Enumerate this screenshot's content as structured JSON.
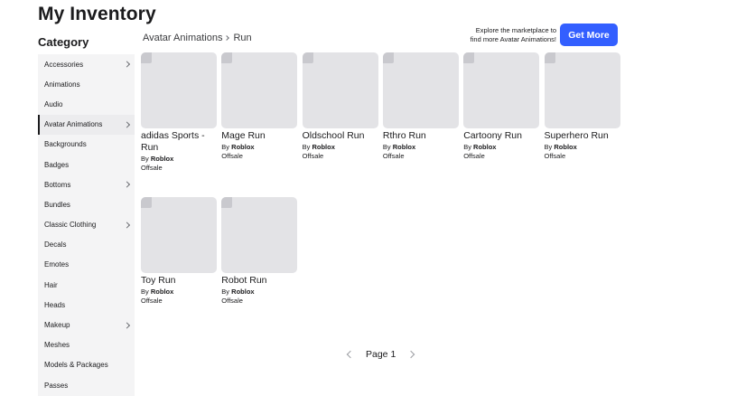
{
  "page_title": "My Inventory",
  "category_heading": "Category",
  "sidebar": {
    "items": [
      {
        "label": "Accessories",
        "has_children": true,
        "active": false
      },
      {
        "label": "Animations",
        "has_children": false,
        "active": false
      },
      {
        "label": "Audio",
        "has_children": false,
        "active": false
      },
      {
        "label": "Avatar Animations",
        "has_children": true,
        "active": true
      },
      {
        "label": "Backgrounds",
        "has_children": false,
        "active": false
      },
      {
        "label": "Badges",
        "has_children": false,
        "active": false
      },
      {
        "label": "Bottoms",
        "has_children": true,
        "active": false
      },
      {
        "label": "Bundles",
        "has_children": false,
        "active": false
      },
      {
        "label": "Classic Clothing",
        "has_children": true,
        "active": false
      },
      {
        "label": "Decals",
        "has_children": false,
        "active": false
      },
      {
        "label": "Emotes",
        "has_children": false,
        "active": false
      },
      {
        "label": "Hair",
        "has_children": false,
        "active": false
      },
      {
        "label": "Heads",
        "has_children": false,
        "active": false
      },
      {
        "label": "Makeup",
        "has_children": true,
        "active": false
      },
      {
        "label": "Meshes",
        "has_children": false,
        "active": false
      },
      {
        "label": "Models & Packages",
        "has_children": false,
        "active": false
      },
      {
        "label": "Passes",
        "has_children": false,
        "active": false
      }
    ]
  },
  "breadcrumb": {
    "parent": "Avatar Animations",
    "current": "Run"
  },
  "promo": {
    "line1": "Explore the marketplace to",
    "line2": "find more Avatar Animations!",
    "button_label": "Get More"
  },
  "items": [
    {
      "name": "adidas Sports - Run",
      "by_prefix": "By",
      "creator": "Roblox",
      "status": "Offsale"
    },
    {
      "name": "Mage Run",
      "by_prefix": "By",
      "creator": "Roblox",
      "status": "Offsale"
    },
    {
      "name": "Oldschool Run",
      "by_prefix": "By",
      "creator": "Roblox",
      "status": "Offsale"
    },
    {
      "name": "Rthro Run",
      "by_prefix": "By",
      "creator": "Roblox",
      "status": "Offsale"
    },
    {
      "name": "Cartoony Run",
      "by_prefix": "By",
      "creator": "Roblox",
      "status": "Offsale"
    },
    {
      "name": "Superhero Run",
      "by_prefix": "By",
      "creator": "Roblox",
      "status": "Offsale"
    },
    {
      "name": "Toy Run",
      "by_prefix": "By",
      "creator": "Roblox",
      "status": "Offsale"
    },
    {
      "name": "Robot Run",
      "by_prefix": "By",
      "creator": "Roblox",
      "status": "Offsale"
    }
  ],
  "pagination": {
    "label": "Page 1"
  },
  "colors": {
    "accent": "#335fff",
    "thumbnail_placeholder": "#e3e3e6",
    "sidebar_bg": "#f4f4f5"
  }
}
